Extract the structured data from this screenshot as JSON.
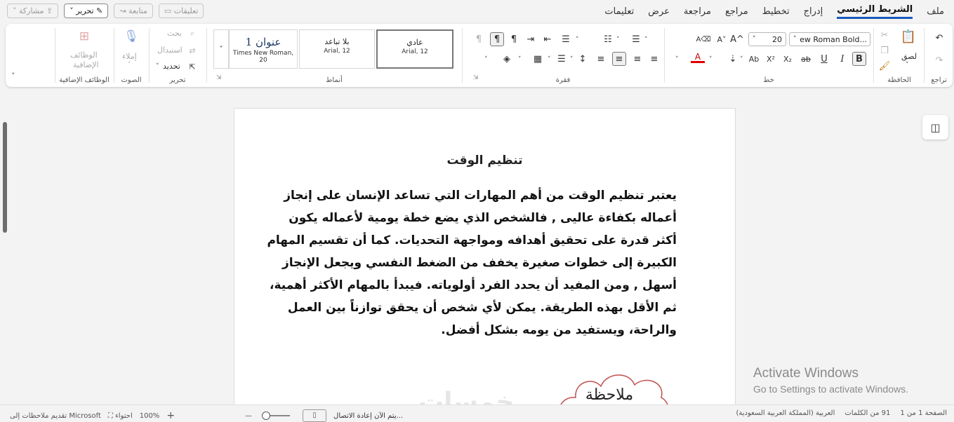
{
  "menu": {
    "items": [
      "ملف",
      "الشريط الرئيسي",
      "إدراج",
      "تخطيط",
      "مراجع",
      "مراجعة",
      "عرض",
      "تعليمات"
    ],
    "share_label": "مشاركة",
    "edit_label": "تحرير",
    "follow_label": "متابعة",
    "comments_label": "تعليقات"
  },
  "ribbon": {
    "undo_group": "تراجع",
    "clipboard": {
      "paste": "لصق",
      "label": "الحافظة"
    },
    "font": {
      "name": "...ew Roman Bold",
      "size": "20",
      "label": "خط",
      "bold": "B",
      "italic": "I",
      "underline": "U",
      "strike": "ab",
      "subscript": "X₂",
      "superscript": "X²",
      "change_case": "Ab",
      "grow": "A^",
      "shrink": "A˅",
      "clear": "A⌫"
    },
    "paragraph": {
      "label": "فقرة"
    },
    "styles": {
      "label": "أنماط",
      "items": [
        {
          "name": "عادي",
          "font": "Arial, 12"
        },
        {
          "name": "بلا تباعد",
          "font": "Arial, 12"
        },
        {
          "name": "عنوان 1",
          "font": "Times New Roman, 20"
        }
      ]
    },
    "editing": {
      "find": "بحث",
      "replace": "استبدال",
      "select": "تحديد",
      "label": "تحرير"
    },
    "voice": {
      "dictate": "إملاء",
      "label": "الصوت"
    },
    "addins": {
      "name_line1": "الوظائف",
      "name_line2": "الإضافية",
      "label": "الوظائف الإضافية"
    }
  },
  "document": {
    "title": "تنظيم الوقت",
    "lines": [
      "يعتبر تنظيم الوقت من أهم المهارات التي تساعد الإنسان على إنجاز",
      "أعماله بكفاءة عاليى  , فالشخص الذي يضع خطة يومية لأعماله يكون",
      "أكثر قدرة على تحقيق أهدافه ومواجهة التحديات. كما أن تقسيم المهام",
      "الكبيرة إلى خطوات صغيرة يخفف من الضغط النفسي ويجعل الإنجاز",
      "أسهل  , ومن المفيد أن يحدد الفرد أولوياته. فيبدأ بالمهام الأكثر أهمية،",
      "ثم الأقل بهذه الطريقة. يمكن لأي شخص أن يحقق توازناً بين العمل",
      "والراحة، ويستفيد من يومه بشكل أفضل."
    ],
    "note_label": "ملاحظة"
  },
  "overlay": {
    "activate_title": "Activate Windows",
    "activate_sub": "Go to Settings to activate Windows.",
    "watermark": "خمسات"
  },
  "status": {
    "page": "الصفحة 1 من 1",
    "words": "91 من الكلمات",
    "language": "العربية (المملكة العربية السعودية)",
    "reconnecting": "يتم الآن إعادة الاتصال...",
    "zoom": "100%",
    "fit": "احتواء",
    "feedback": "تقديم ملاحظات إلى Microsoft"
  }
}
